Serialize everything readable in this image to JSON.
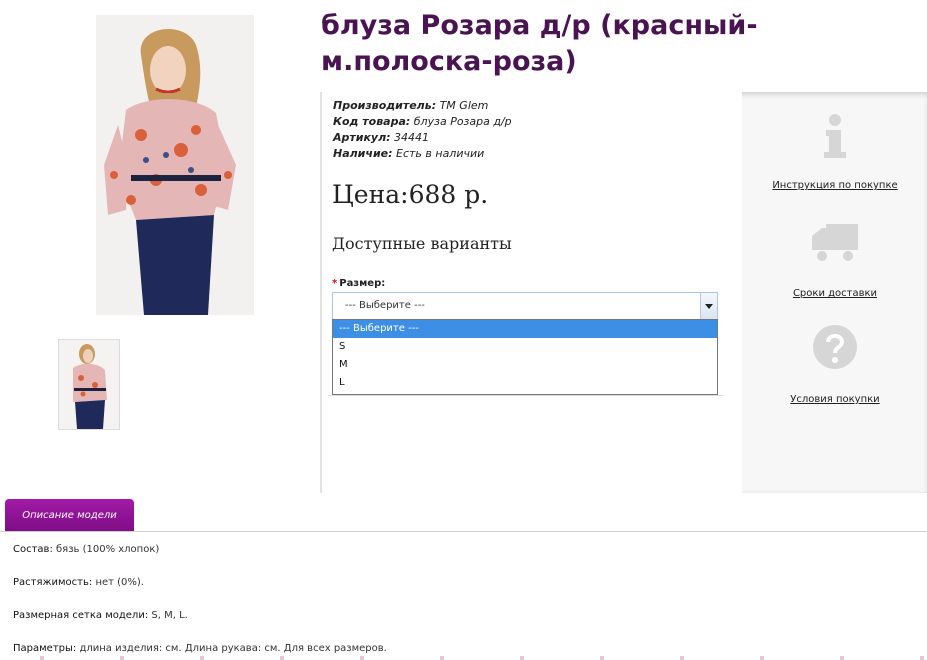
{
  "product": {
    "title": "блуза Розара д/р (красный-м.полоска-роза)",
    "specs": [
      {
        "label": "Производитель:",
        "value": " TM Glem"
      },
      {
        "label": "Код товара:",
        "value": " блуза Розара д/р"
      },
      {
        "label": "Артикул:",
        "value": " 34441"
      },
      {
        "label": "Наличие:",
        "value": " Есть в наличии"
      }
    ],
    "price": "Цена:688 р.",
    "variants_heading": "Доступные варианты"
  },
  "size_select": {
    "required_mark": "*",
    "label": "Размер:",
    "selected": "--- Выберите ---",
    "options": [
      "--- Выберите ---",
      "S",
      "M",
      "L"
    ]
  },
  "help_links": [
    {
      "label": "Инструкция по покупке",
      "icon": "info-icon"
    },
    {
      "label": "Сроки доставки",
      "icon": "truck-icon"
    },
    {
      "label": "Условия покупки",
      "icon": "question-icon"
    }
  ],
  "tabs": [
    {
      "label": "Описание модели"
    }
  ],
  "description": [
    {
      "label": "Состав:",
      "value": " бязь (100% хлопок)"
    },
    {
      "label": "Растяжимость:",
      "value": " нет (0%)."
    },
    {
      "label": "Размерная сетка модели:",
      "value": " S, M, L."
    },
    {
      "label": "Параметры:",
      "value": " длина изделия: см. Длина рукава: см. Для всех размеров."
    }
  ],
  "colors": {
    "title": "#4a1352",
    "tab": "#8f1296",
    "select_highlight": "#3d8fe6"
  }
}
